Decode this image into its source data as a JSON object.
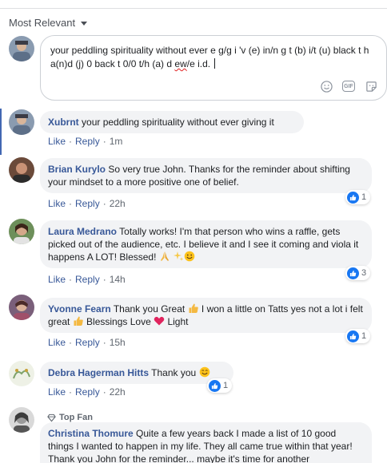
{
  "sort": {
    "label": "Most Relevant"
  },
  "composer": {
    "text_before": "your peddling spirituality without ever e g/g i 'v (e) in/n g t (b) i/t (u) black t h a(n)d (j) 0 back t 0/0 t/h (a) d ",
    "text_spell": "ew",
    "text_after": "/e i.d. ",
    "icons": [
      "smiley-icon",
      "gif-icon",
      "sticker-icon"
    ],
    "gif_label": "GIF"
  },
  "comments": [
    {
      "name": "Xubrnt",
      "text": "your peddling spirituality without ever giving it",
      "like": "Like",
      "reply": "Reply",
      "time": "1m"
    },
    {
      "name": "Brian Kurylo",
      "text": "So very true John. Thanks for the reminder about shifting your mindset to a more positive one of belief.",
      "like": "Like",
      "reply": "Reply",
      "time": "22h",
      "reactions": "1"
    },
    {
      "name": "Laura Medrano",
      "text_a": "Totally works! I'm that person who wins a raffle, gets picked out of the audience, etc. I believe it and I see it coming and viola it happens A LOT! Blessed!",
      "like": "Like",
      "reply": "Reply",
      "time": "14h",
      "reactions": "3"
    },
    {
      "name": "Yvonne Fearn",
      "text_a": "Thank you Great",
      "text_b": "I won a little on Tatts yes not a lot i felt great",
      "text_c": "Blessings Love",
      "text_d": "Light",
      "like": "Like",
      "reply": "Reply",
      "time": "15h",
      "reactions": "1"
    },
    {
      "name": "Debra Hagerman Hitts",
      "text_a": "Thank you",
      "like": "Like",
      "reply": "Reply",
      "time": "22h",
      "reactions": "1"
    },
    {
      "badge": "Top Fan",
      "name": "Christina Thomure",
      "text": "Quite a few years back I made a list of 10 good things I wanted to happen in my life. They all came true within that year! Thank you John for the reminder... maybe it's time for another"
    }
  ],
  "colors": {
    "link": "#385898",
    "bubble": "#f2f3f5",
    "like_blue": "#1877f2",
    "accent_bar": "#4267b2"
  }
}
